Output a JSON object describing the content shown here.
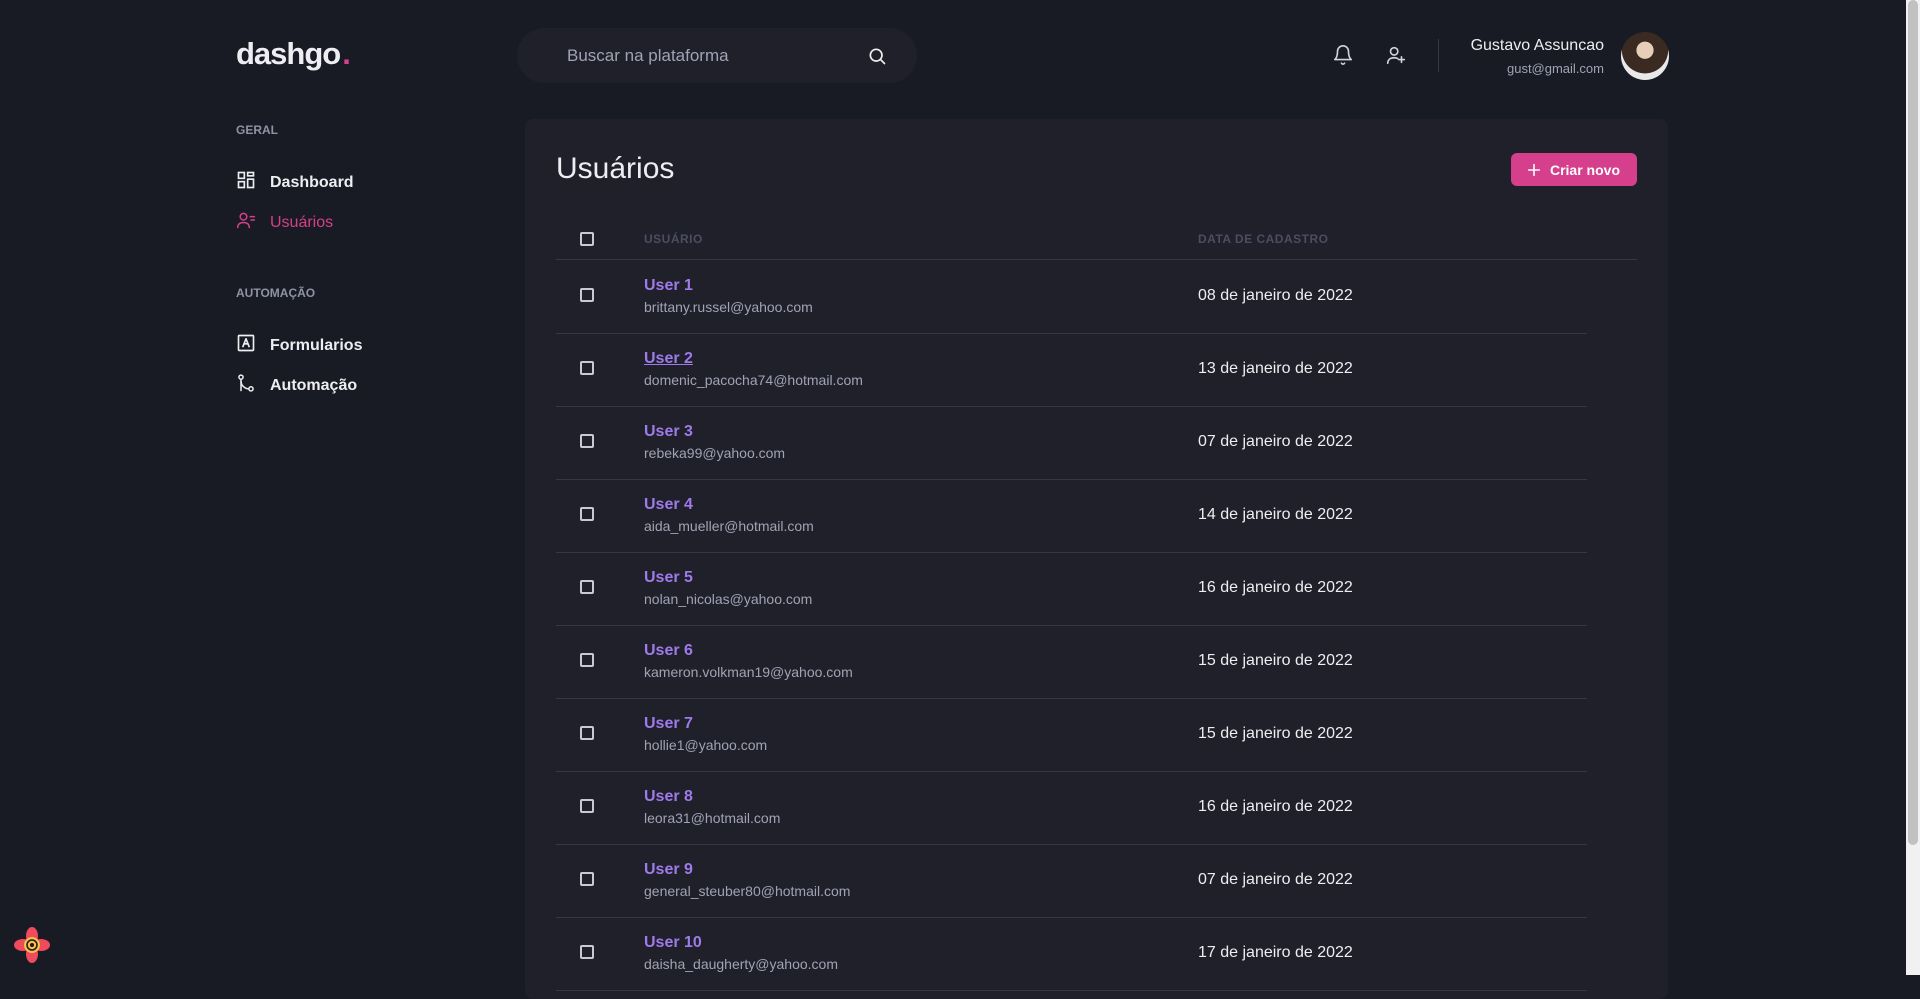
{
  "brand": {
    "name": "dashgo",
    "dot": ".",
    "accent": "#d53f8c"
  },
  "search": {
    "placeholder": "Buscar na plataforma",
    "icon": "search-icon"
  },
  "header": {
    "notifications_icon": "bell-icon",
    "add_user_icon": "user-add-icon",
    "user": {
      "name": "Gustavo Assuncao",
      "email": "gust@gmail.com"
    }
  },
  "sidebar": {
    "sections": [
      {
        "title": "GERAL",
        "items": [
          {
            "label": "Dashboard",
            "icon": "dashboard-icon",
            "active": false
          },
          {
            "label": "Usuários",
            "icon": "users-icon",
            "active": true
          }
        ]
      },
      {
        "title": "AUTOMAÇÃO",
        "items": [
          {
            "label": "Formularios",
            "icon": "form-icon",
            "active": false
          },
          {
            "label": "Automação",
            "icon": "git-merge-icon",
            "active": false
          }
        ]
      }
    ]
  },
  "main": {
    "title": "Usuários",
    "create_button": "Criar novo",
    "columns": {
      "user": "USUÁRIO",
      "date": "DATA DE CADASTRO"
    },
    "users": [
      {
        "name": "User 1",
        "email": "brittany.russel@yahoo.com",
        "date": "08 de janeiro de 2022"
      },
      {
        "name": "User 2",
        "email": "domenic_pacocha74@hotmail.com",
        "date": "13 de janeiro de 2022"
      },
      {
        "name": "User 3",
        "email": "rebeka99@yahoo.com",
        "date": "07 de janeiro de 2022"
      },
      {
        "name": "User 4",
        "email": "aida_mueller@hotmail.com",
        "date": "14 de janeiro de 2022"
      },
      {
        "name": "User 5",
        "email": "nolan_nicolas@yahoo.com",
        "date": "16 de janeiro de 2022"
      },
      {
        "name": "User 6",
        "email": "kameron.volkman19@yahoo.com",
        "date": "15 de janeiro de 2022"
      },
      {
        "name": "User 7",
        "email": "hollie1@yahoo.com",
        "date": "15 de janeiro de 2022"
      },
      {
        "name": "User 8",
        "email": "leora31@hotmail.com",
        "date": "16 de janeiro de 2022"
      },
      {
        "name": "User 9",
        "email": "general_steuber80@hotmail.com",
        "date": "07 de janeiro de 2022"
      },
      {
        "name": "User 10",
        "email": "daisha_daugherty@yahoo.com",
        "date": "17 de janeiro de 2022"
      }
    ]
  },
  "colors": {
    "background": "#181b23",
    "panel": "#1f2029",
    "link": "#9f7aea",
    "accent": "#d53f8c"
  }
}
